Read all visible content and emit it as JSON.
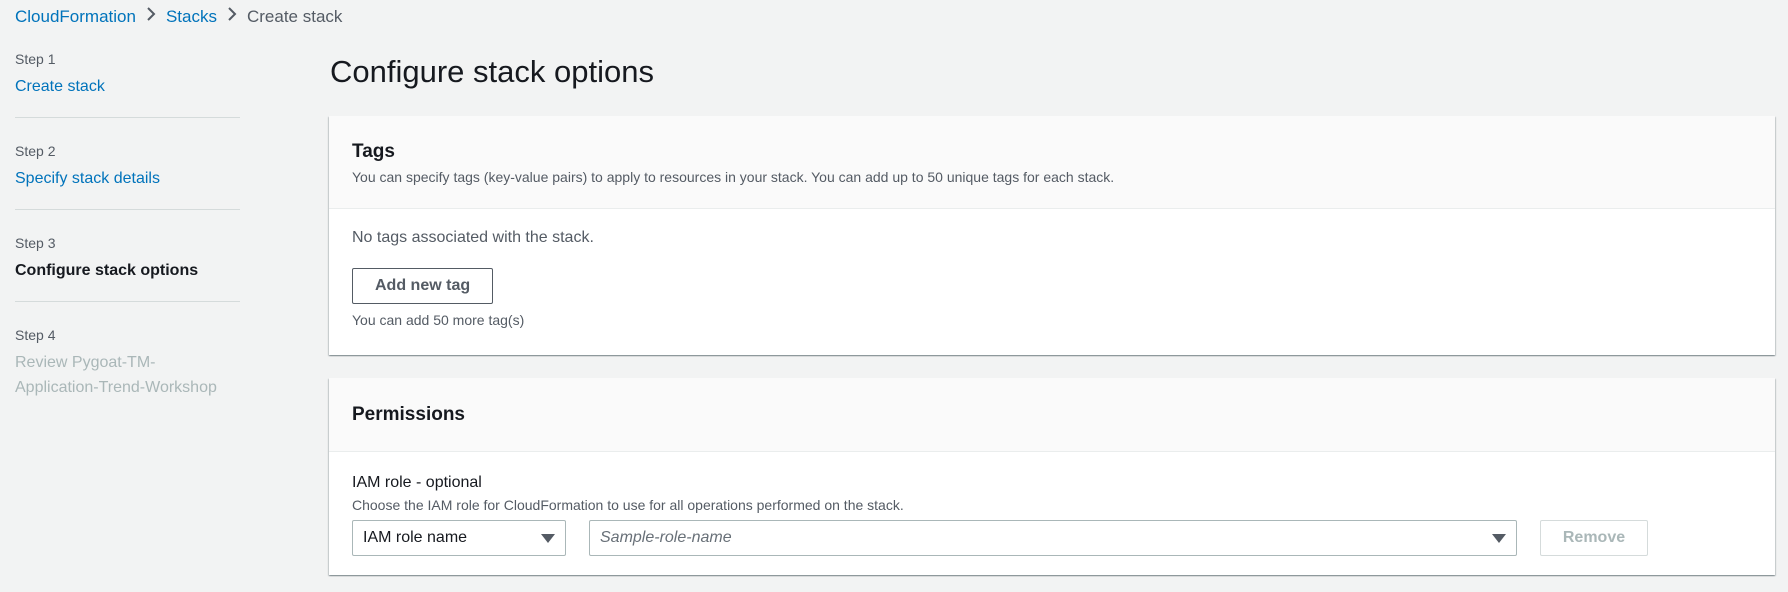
{
  "breadcrumb": {
    "items": [
      {
        "label": "CloudFormation"
      },
      {
        "label": "Stacks"
      },
      {
        "label": "Create stack"
      }
    ],
    "separator_icon": "chevron-right-icon"
  },
  "steps": [
    {
      "number": "Step 1",
      "label": "Create stack",
      "state": "link"
    },
    {
      "number": "Step 2",
      "label": "Specify stack details",
      "state": "link"
    },
    {
      "number": "Step 3",
      "label": "Configure stack options",
      "state": "active"
    },
    {
      "number": "Step 4",
      "label_line1": "Review Pygoat-TM-",
      "label_line2": "Application-Trend-Workshop",
      "state": "disabled"
    }
  ],
  "page": {
    "title": "Configure stack options"
  },
  "tags": {
    "title": "Tags",
    "description": "You can specify tags (key-value pairs) to apply to resources in your stack. You can add up to 50 unique tags for each stack.",
    "empty_text": "No tags associated with the stack.",
    "add_button": "Add new tag",
    "hint": "You can add 50 more tag(s)"
  },
  "permissions": {
    "title": "Permissions",
    "iam_label": "IAM role - optional",
    "iam_description": "Choose the IAM role for CloudFormation to use for all operations performed on the stack.",
    "type_select_value": "IAM role name",
    "role_placeholder": "Sample-role-name",
    "remove_button": "Remove"
  },
  "colors": {
    "link": "#0073bb",
    "background": "#f2f3f3",
    "disabled": "#aab7b8"
  }
}
